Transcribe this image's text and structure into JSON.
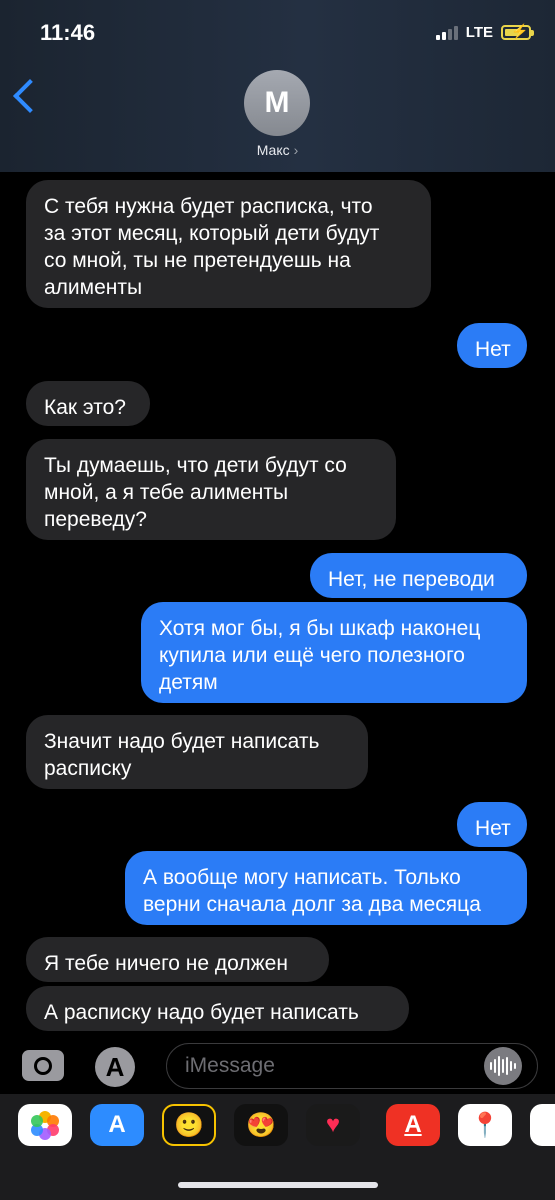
{
  "status": {
    "time": "11:46",
    "network": "LTE"
  },
  "contact": {
    "initial": "M",
    "name": "Макс",
    "chevron": "›"
  },
  "messages": [
    {
      "from": "them",
      "text": "С тебя нужна будет расписка, что\nза этот месяц, который дети будут\nсо мной, ты не претендуешь на\nалименты"
    },
    {
      "from": "me",
      "text": "Нет"
    },
    {
      "from": "them",
      "text": "Как это?"
    },
    {
      "from": "them",
      "text": "Ты думаешь, что дети будут со\nмной, а я тебе алименты\nпереведу?"
    },
    {
      "from": "me",
      "text": "Нет, не переводи"
    },
    {
      "from": "me",
      "text": "Хотя мог бы, я бы шкаф наконец\nкупила или ещё чего полезного\nдетям"
    },
    {
      "from": "them",
      "text": "Значит надо будет написать\nрасписку"
    },
    {
      "from": "me",
      "text": "Нет"
    },
    {
      "from": "me",
      "text": "А вообще могу написать. Только\nверни сначала долг за два месяца"
    },
    {
      "from": "them",
      "text": "Я тебе ничего не должен"
    },
    {
      "from": "them",
      "text": "А расписку надо будет написать"
    }
  ],
  "composer": {
    "placeholder": "iMessage",
    "appstore_glyph": "A"
  },
  "app_drawer": [
    {
      "icon": "photos-icon",
      "glyph": "✿",
      "color": "#ffffff"
    },
    {
      "icon": "app-store-icon",
      "glyph": "A",
      "color": "#2d8cff"
    },
    {
      "icon": "memoji-icon",
      "glyph": "🙂",
      "color": "#111111"
    },
    {
      "icon": "memoji-stickers-icon",
      "glyph": "😍",
      "color": "#111111"
    },
    {
      "icon": "digital-touch-icon",
      "glyph": "♥",
      "color": "#1a1a1a"
    },
    {
      "icon": "alfa-bank-icon",
      "glyph": "A",
      "color": "#ef3124"
    },
    {
      "icon": "google-maps-icon",
      "glyph": "📍",
      "color": "#ffffff"
    },
    {
      "icon": "partial-app-icon",
      "glyph": "",
      "color": "#ffffff"
    }
  ],
  "colors": {
    "incoming": "#262628",
    "outgoing": "#2b7cf6",
    "accent": "#2f8bff"
  }
}
